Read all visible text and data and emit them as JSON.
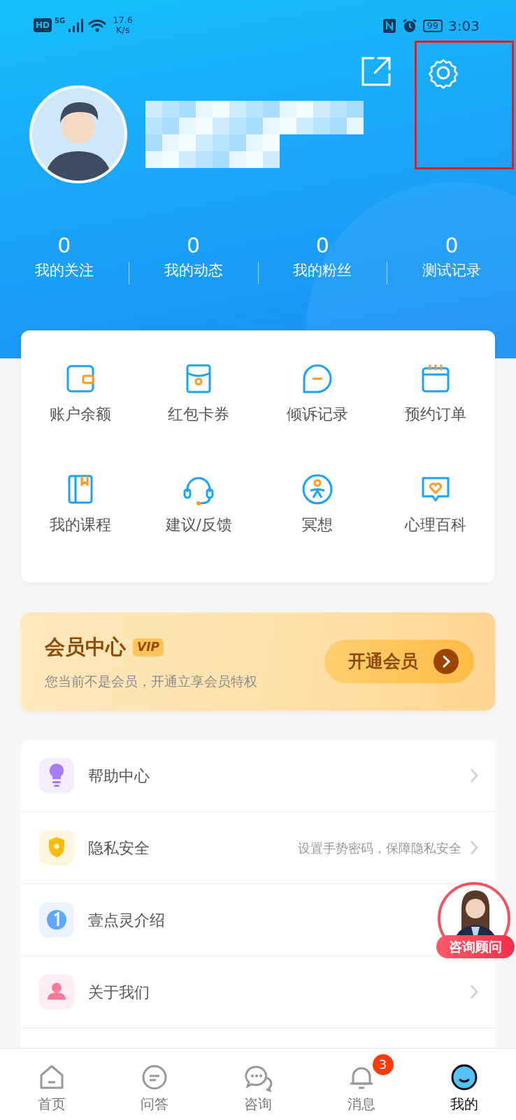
{
  "status_bar": {
    "hd": "HD",
    "network": "5G",
    "speed_value": "17.6",
    "speed_unit": "K/s",
    "battery": "99",
    "time": "3:03"
  },
  "profile": {
    "stats": [
      {
        "value": "0",
        "label": "我的关注"
      },
      {
        "value": "0",
        "label": "我的动态"
      },
      {
        "value": "0",
        "label": "我的粉丝"
      },
      {
        "value": "0",
        "label": "测试记录"
      }
    ]
  },
  "services": [
    {
      "label": "账户余额",
      "kind": "wallet"
    },
    {
      "label": "红包卡券",
      "kind": "envelope"
    },
    {
      "label": "倾诉记录",
      "kind": "chat"
    },
    {
      "label": "预约订单",
      "kind": "calendar"
    },
    {
      "label": "我的课程",
      "kind": "book"
    },
    {
      "label": "建议/反馈",
      "kind": "headset"
    },
    {
      "label": "冥想",
      "kind": "meditate"
    },
    {
      "label": "心理百科",
      "kind": "heart"
    }
  ],
  "vip": {
    "title": "会员中心",
    "badge": "VIP",
    "subtitle": "您当前不是会员，开通立享会员特权",
    "button": "开通会员"
  },
  "menu": [
    {
      "label": "帮助中心",
      "kind": "bulb",
      "color": "#a87cf6",
      "chevron": true
    },
    {
      "label": "隐私安全",
      "kind": "shield",
      "color": "#fbbd08",
      "hint": "设置手势密码，保障隐私安全",
      "chevron": true
    },
    {
      "label": "壹点灵介绍",
      "kind": "one",
      "color": "#5fa8fb",
      "chevron": false
    },
    {
      "label": "关于我们",
      "kind": "person",
      "color": "#f7789a",
      "chevron": true
    }
  ],
  "advisor": {
    "label": "咨询顾问"
  },
  "tab_bar": [
    {
      "label": "首页",
      "kind": "home",
      "selected": false
    },
    {
      "label": "问答",
      "kind": "qa",
      "selected": false
    },
    {
      "label": "咨询",
      "kind": "consult",
      "selected": false
    },
    {
      "label": "消息",
      "kind": "bell",
      "selected": false,
      "badge": "3"
    },
    {
      "label": "我的",
      "kind": "me",
      "selected": true
    }
  ]
}
